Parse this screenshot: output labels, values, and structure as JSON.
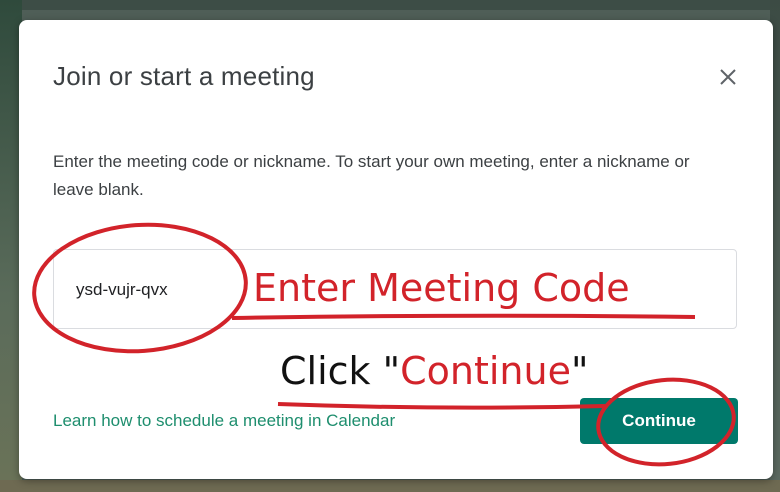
{
  "dialog": {
    "title": "Join or start a meeting",
    "description": "Enter the meeting code or nickname. To start your own meeting, enter a nickname or leave blank.",
    "code_input": {
      "value": "ysd-vujr-qvx"
    },
    "learn_link": "Learn how to schedule a meeting in Calendar",
    "continue_label": "Continue",
    "close_icon": "close-icon"
  },
  "annotations": {
    "enter_code": "Enter Meeting Code",
    "click_prefix": "Click \"",
    "click_word": "Continue",
    "click_suffix": "\""
  },
  "colors": {
    "accent": "#00796b",
    "link": "#1e8e6e",
    "annotation_red": "#d2232a"
  }
}
